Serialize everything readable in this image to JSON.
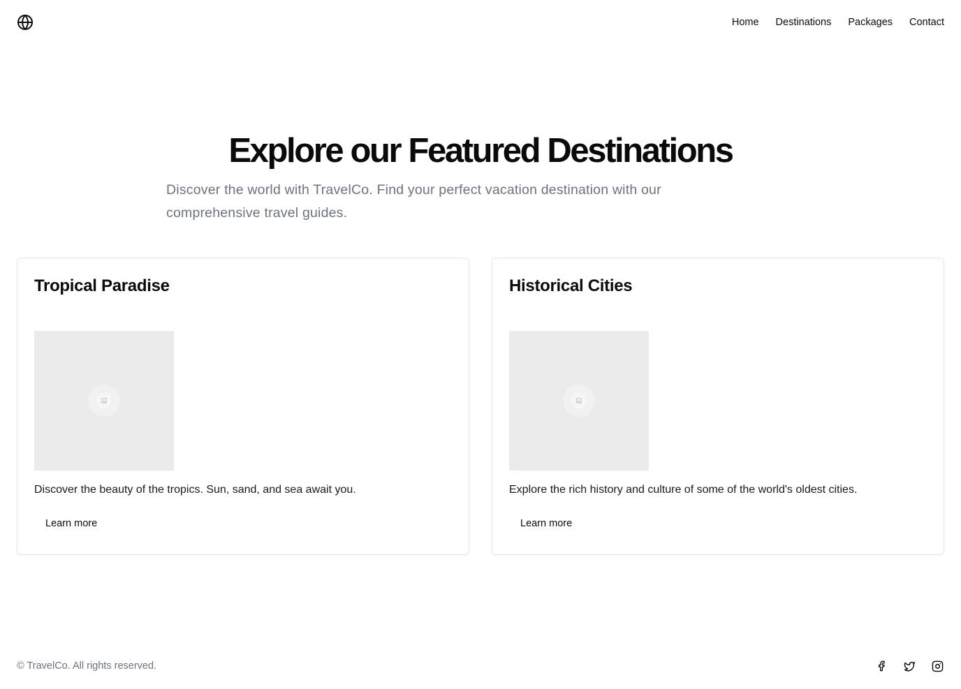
{
  "header": {
    "logo_icon": "globe-icon",
    "nav": [
      {
        "label": "Home"
      },
      {
        "label": "Destinations"
      },
      {
        "label": "Packages"
      },
      {
        "label": "Contact"
      }
    ]
  },
  "hero": {
    "title": "Explore our Featured Destinations",
    "subtitle": "Discover the world with TravelCo. Find your perfect vacation destination with our comprehensive travel guides."
  },
  "cards": [
    {
      "title": "Tropical Paradise",
      "image_icon": "image-placeholder-icon",
      "description": "Discover the beauty of the tropics. Sun, sand, and sea await you.",
      "button": "Learn more"
    },
    {
      "title": "Historical Cities",
      "image_icon": "image-placeholder-icon",
      "description": "Explore the rich history and culture of some of the world's oldest cities.",
      "button": "Learn more"
    }
  ],
  "footer": {
    "copyright": "© TravelCo. All rights reserved.",
    "socials": [
      "facebook-icon",
      "twitter-icon",
      "instagram-icon"
    ]
  },
  "colors": {
    "text": "#0a0a0a",
    "muted": "#6b7280",
    "border": "#e5e7eb",
    "placeholder": "#ebebeb"
  }
}
